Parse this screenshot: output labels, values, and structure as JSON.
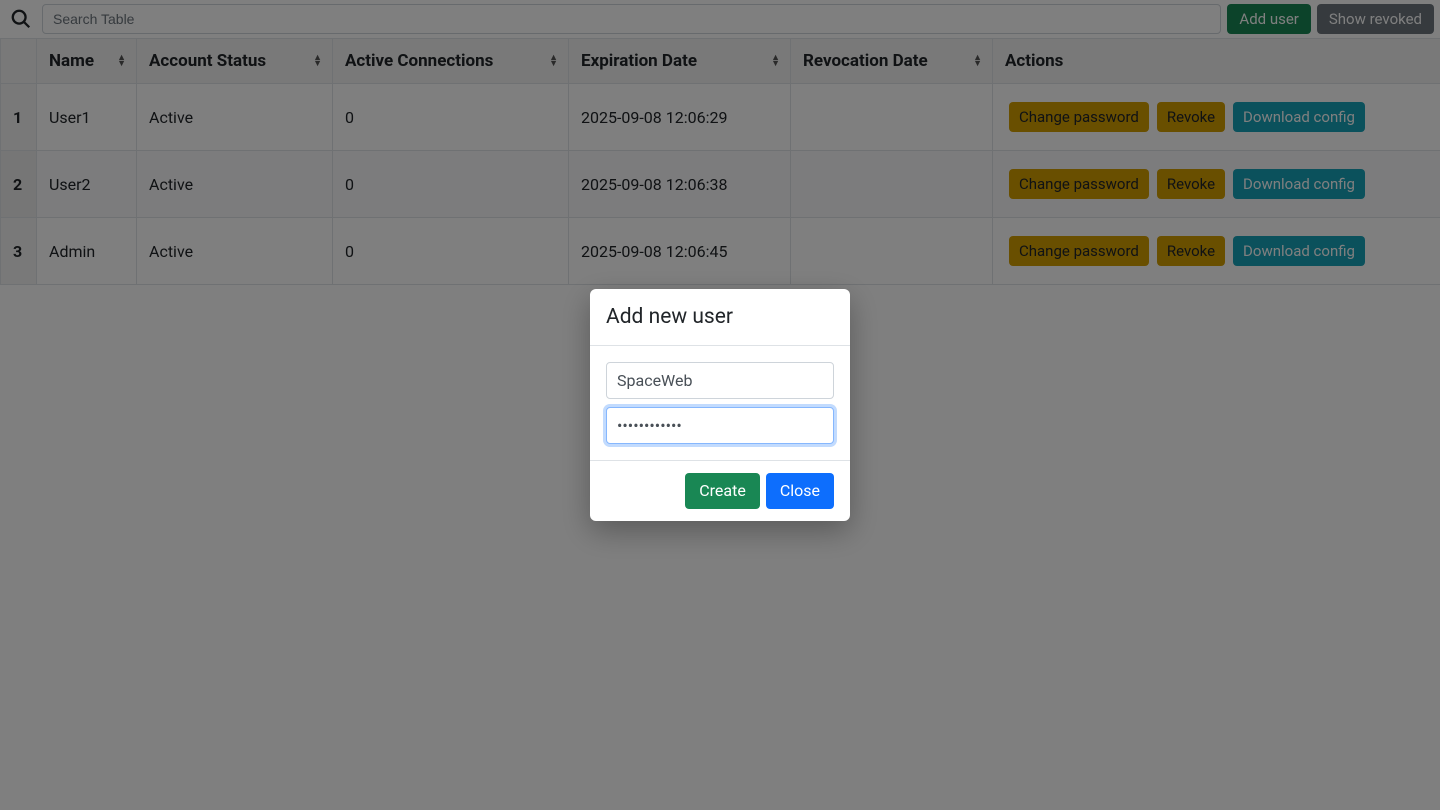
{
  "toolbar": {
    "search_placeholder": "Search Table",
    "add_user_label": "Add user",
    "show_revoked_label": "Show revoked"
  },
  "table": {
    "headers": {
      "name": "Name",
      "status": "Account Status",
      "connections": "Active Connections",
      "expiration": "Expiration Date",
      "revocation": "Revocation Date",
      "actions": "Actions"
    },
    "action_labels": {
      "change_password": "Change password",
      "revoke": "Revoke",
      "download": "Download config"
    },
    "rows": [
      {
        "idx": "1",
        "name": "User1",
        "status": "Active",
        "connections": "0",
        "expiration": "2025-09-08 12:06:29",
        "revocation": ""
      },
      {
        "idx": "2",
        "name": "User2",
        "status": "Active",
        "connections": "0",
        "expiration": "2025-09-08 12:06:38",
        "revocation": ""
      },
      {
        "idx": "3",
        "name": "Admin",
        "status": "Active",
        "connections": "0",
        "expiration": "2025-09-08 12:06:45",
        "revocation": ""
      }
    ]
  },
  "modal": {
    "title": "Add new user",
    "username_value": "SpaceWeb",
    "password_value": "••••••••••••",
    "create_label": "Create",
    "close_label": "Close"
  }
}
